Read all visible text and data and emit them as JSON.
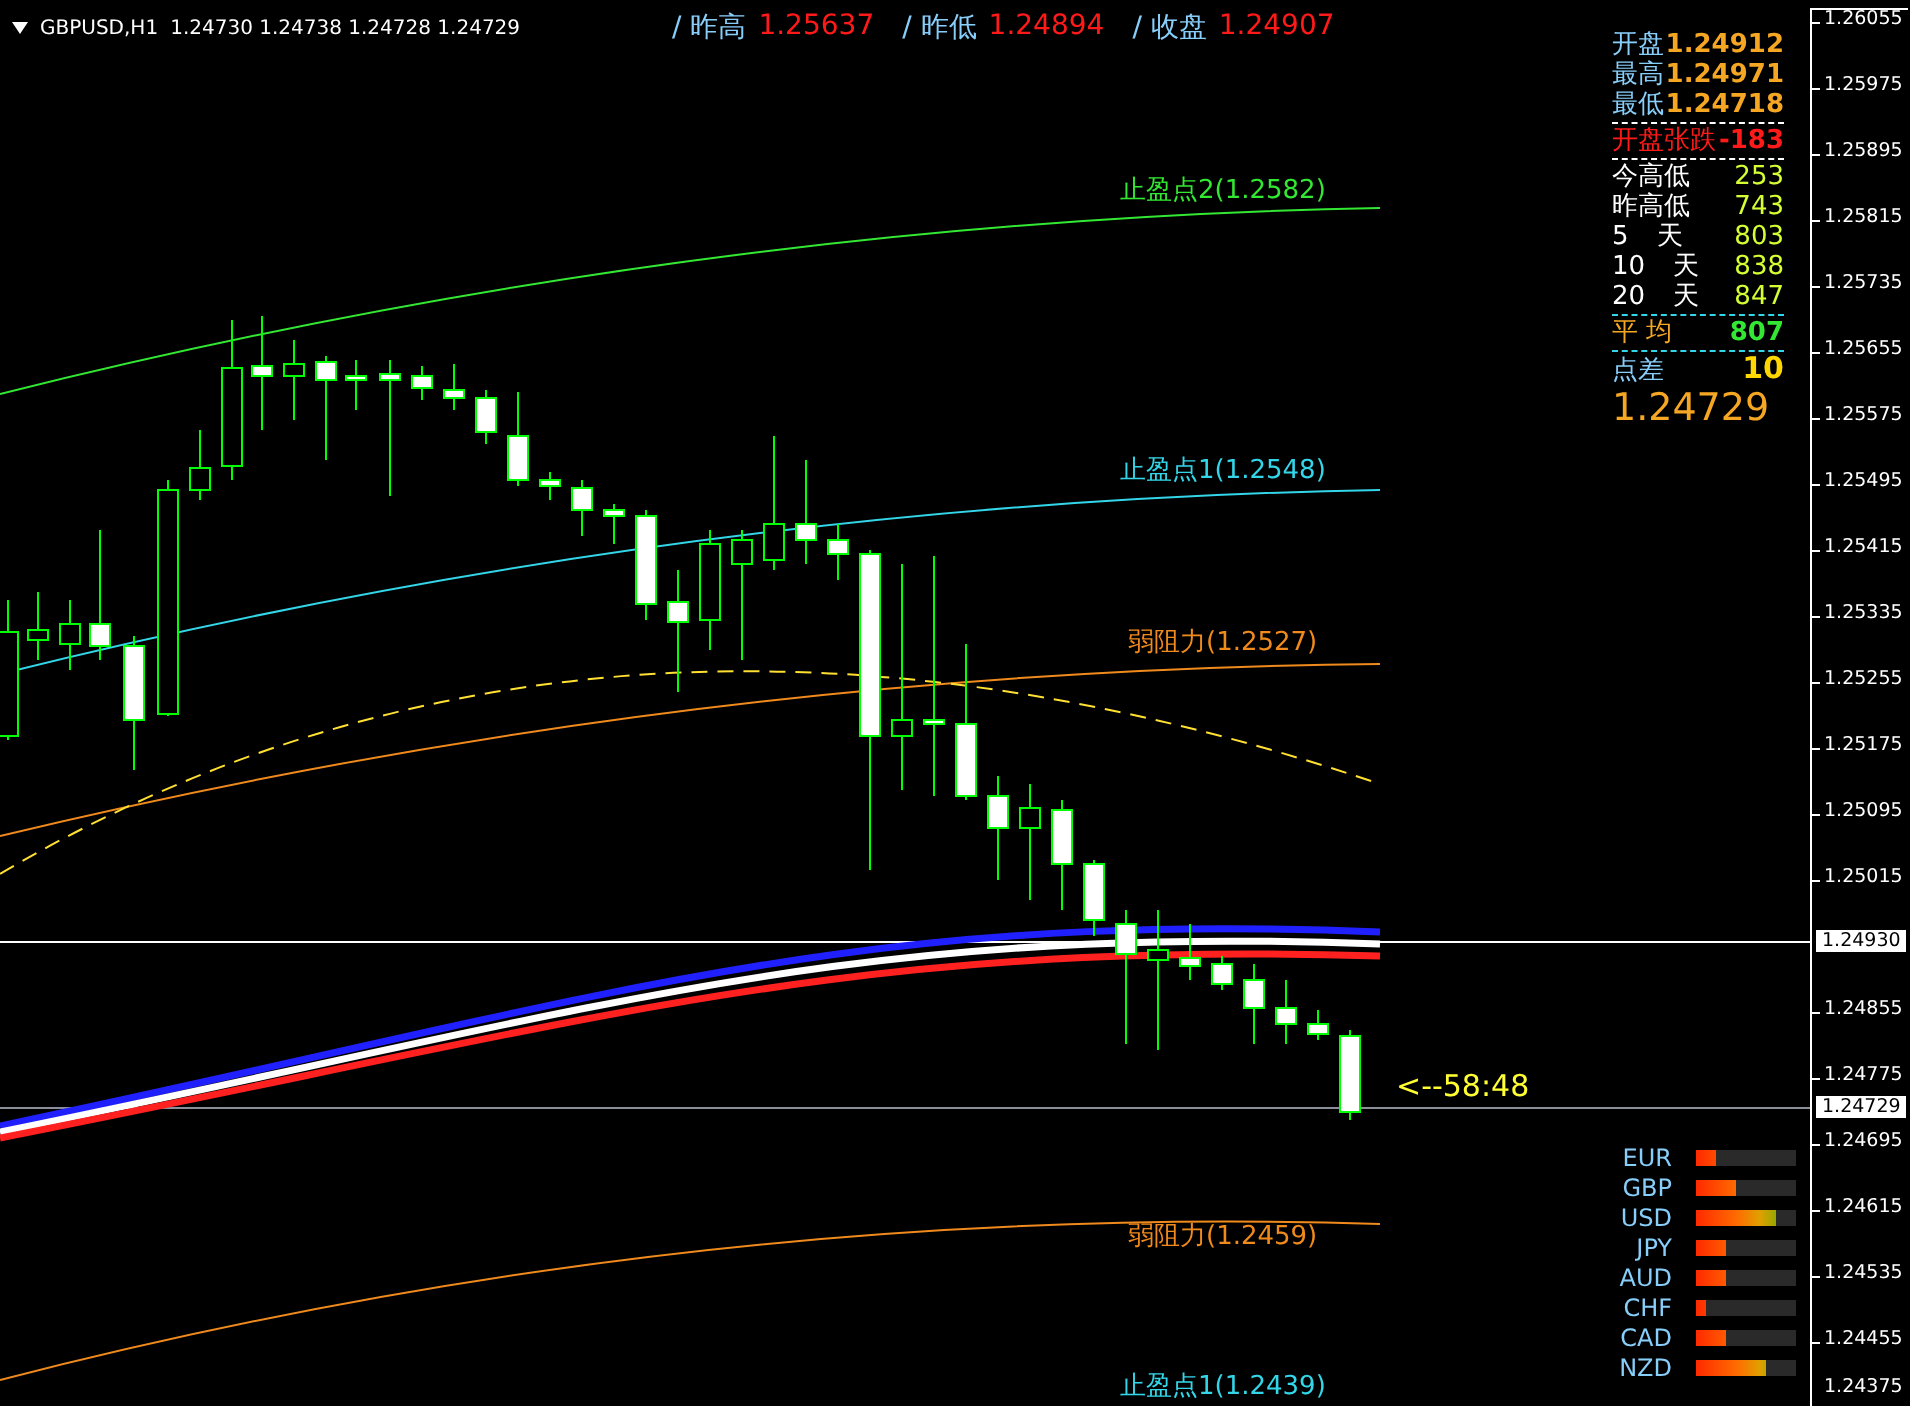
{
  "symbol_bar": {
    "title": "GBPUSD,H1",
    "quote": "1.24730 1.24738 1.24728 1.24729",
    "stats": [
      {
        "label": "/ 昨高",
        "value": "1.25637"
      },
      {
        "label": "/ 昨低",
        "value": "1.24894"
      },
      {
        "label": "/ 收盘",
        "value": "1.24907"
      }
    ]
  },
  "levels": [
    {
      "label": "止盈点2(1.2582)",
      "color": "#33e833"
    },
    {
      "label": "止盈点1(1.2548)",
      "color": "#33d6e8"
    },
    {
      "label": "弱阻力(1.2527)",
      "color": "#f08a1c"
    },
    {
      "label": "弱阻力(1.2459)",
      "color": "#f08a1c"
    },
    {
      "label": "止盈点1(1.2439)",
      "color": "#33d6e8"
    }
  ],
  "countdown": "<--58:48",
  "info_panel": {
    "quote_rows": [
      {
        "label": "开盘",
        "value": "1.24912"
      },
      {
        "label": "最高",
        "value": "1.24971"
      },
      {
        "label": "最低",
        "value": "1.24718"
      }
    ],
    "change": {
      "label": "开盘张跌",
      "value": "-183"
    },
    "range_rows": [
      {
        "label": "今高低",
        "value": "253"
      },
      {
        "label": "昨高低",
        "value": "743"
      },
      {
        "label": "5",
        "unit": "天",
        "value": "803"
      },
      {
        "label": "10",
        "unit": "天",
        "value": "838"
      },
      {
        "label": "20",
        "unit": "天",
        "value": "847"
      }
    ],
    "average": {
      "label": "平 均",
      "value": "807"
    },
    "spread": {
      "label": "点差",
      "value": "10"
    },
    "price": "1.24729"
  },
  "currency_strength": [
    {
      "name": "EUR",
      "level": 0.2
    },
    {
      "name": "GBP",
      "level": 0.4
    },
    {
      "name": "USD",
      "level": 0.8
    },
    {
      "name": "JPY",
      "level": 0.3
    },
    {
      "name": "AUD",
      "level": 0.3
    },
    {
      "name": "CHF",
      "level": 0.1
    },
    {
      "name": "CAD",
      "level": 0.3
    },
    {
      "name": "NZD",
      "level": 0.7
    }
  ],
  "price_axis": {
    "ticks": [
      "1.26055",
      "1.25975",
      "1.25895",
      "1.25815",
      "1.25735",
      "1.25655",
      "1.25575",
      "1.25495",
      "1.25415",
      "1.25335",
      "1.25255",
      "1.25175",
      "1.25095",
      "1.25015",
      "1.24855",
      "1.24775",
      "1.24695",
      "1.24615",
      "1.24535",
      "1.24455",
      "1.24375"
    ],
    "markers": [
      {
        "value": "1.24930",
        "kind": "line"
      },
      {
        "value": "1.24729",
        "kind": "bid"
      }
    ]
  }
}
